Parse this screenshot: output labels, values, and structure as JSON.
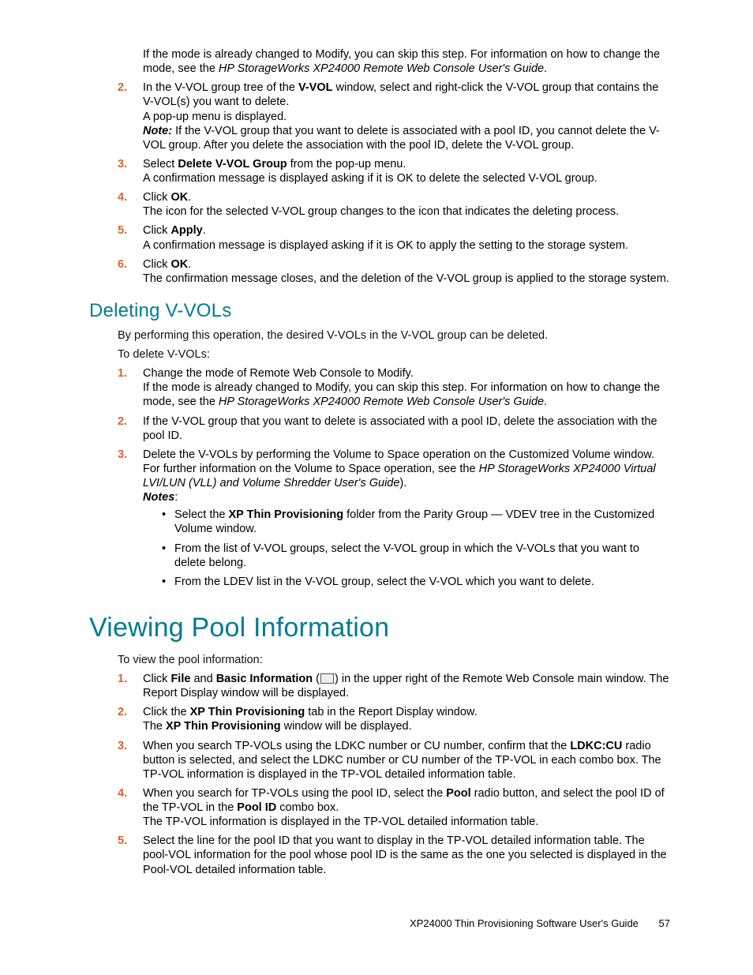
{
  "top": {
    "para": "If the mode is already changed to Modify, you can skip this step. For information on how to change the mode, see the ",
    "guide": "HP StorageWorks XP24000 Remote Web Console User's Guide",
    "period": ".",
    "s2a": "In the V-VOL group tree of the ",
    "s2b": "V-VOL",
    "s2c": " window, select and right-click the V-VOL group that contains the V-VOL(s) you want to delete.",
    "s2d": "A pop-up menu is displayed.",
    "s2note": "Note:",
    "s2e": " If the V-VOL group that you want to delete is associated with a pool ID, you cannot delete the V-VOL group. After you delete the association with the pool ID, delete the V-VOL group.",
    "s3a": "Select ",
    "s3b": "Delete V-VOL Group",
    "s3c": " from the pop-up menu.",
    "s3d": "A confirmation message is displayed asking if it is OK to delete the selected V-VOL group.",
    "s4a": "Click ",
    "s4b": "OK",
    "s4c": ".",
    "s4d": "The icon for the selected V-VOL group changes to the icon that indicates the deleting process.",
    "s5a": "Click ",
    "s5b": "Apply",
    "s5c": ".",
    "s5d": "A confirmation message is displayed asking if it is OK to apply the setting to the storage system.",
    "s6a": "Click ",
    "s6b": "OK",
    "s6c": ".",
    "s6d": "The confirmation message closes, and the deletion of the V-VOL group is applied to the storage system."
  },
  "delvv": {
    "heading": "Deleting V-VOLs",
    "intro": "By performing this operation, the desired V-VOLs in the V-VOL group can be deleted.",
    "lead": "To delete V-VOLs:",
    "s1a": "Change the mode of Remote Web Console to Modify.",
    "s1b": "If the mode is already changed to Modify, you can skip this step. For information on how to change the mode, see the ",
    "s1guide": "HP StorageWorks XP24000 Remote Web Console User's Guide",
    "s1c": ".",
    "s2": "If the V-VOL group that you want to delete is associated with a pool ID, delete the association with the pool ID.",
    "s3a": "Delete the V-VOLs by performing the Volume to Space operation on the Customized Volume window. For further information on the Volume to Space operation, see the ",
    "s3guide": "HP StorageWorks XP24000 Virtual LVI/LUN (VLL) and Volume Shredder User's Guide",
    "s3b": ").",
    "notes": "Notes",
    "colon": ":",
    "b1a": "Select the ",
    "b1b": "XP Thin Provisioning",
    "b1c": " folder from the Parity Group — VDEV tree in the Customized Volume window.",
    "b2": "From the list of V-VOL groups, select the V-VOL group in which the V-VOLs that you want to delete belong.",
    "b3": "From the LDEV list in the V-VOL group, select the V-VOL which you want to delete."
  },
  "pool": {
    "heading": "Viewing Pool Information",
    "lead": "To view the pool information:",
    "s1a": "Click ",
    "s1b": "File",
    "s1c": " and ",
    "s1d": "Basic Information",
    "s1e": " (",
    "s1f": ") in the upper right of the Remote Web Console main window. The Report Display window will be displayed.",
    "s2a": "Click the ",
    "s2b": "XP Thin Provisioning",
    "s2c": " tab in the Report Display window.",
    "s2d": "The ",
    "s2e": "XP Thin Provisioning",
    "s2f": " window will be displayed.",
    "s3a": "When you search TP-VOLs using the LDKC number or CU number, confirm that the ",
    "s3b": "LDKC:CU",
    "s3c": " radio button is selected, and select the LDKC number or CU number of the TP-VOL in each combo box. The TP-VOL information is displayed in the TP-VOL detailed information table.",
    "s4a": "When you search for TP-VOLs using the pool ID, select the ",
    "s4b": "Pool",
    "s4c": " radio button, and select the pool ID of the TP-VOL in the ",
    "s4d": "Pool ID",
    "s4e": " combo box.",
    "s4f": "The TP-VOL information is displayed in the TP-VOL detailed information table.",
    "s5": "Select the line for the pool ID that you want to display in the TP-VOL detailed information table. The pool-VOL information for the pool whose pool ID is the same as the one you selected is displayed in the Pool-VOL detailed information table."
  },
  "footer": {
    "title": "XP24000 Thin Provisioning Software User's Guide",
    "page": "57"
  },
  "nums": {
    "n1": "1.",
    "n2": "2.",
    "n3": "3.",
    "n4": "4.",
    "n5": "5.",
    "n6": "6."
  }
}
